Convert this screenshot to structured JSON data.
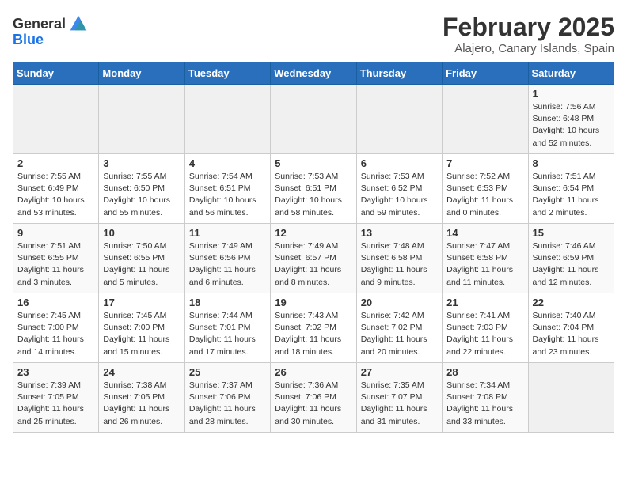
{
  "header": {
    "logo_line1": "General",
    "logo_line2": "Blue",
    "month_title": "February 2025",
    "location": "Alajero, Canary Islands, Spain"
  },
  "days_of_week": [
    "Sunday",
    "Monday",
    "Tuesday",
    "Wednesday",
    "Thursday",
    "Friday",
    "Saturday"
  ],
  "weeks": [
    {
      "days": [
        {
          "num": "",
          "info": ""
        },
        {
          "num": "",
          "info": ""
        },
        {
          "num": "",
          "info": ""
        },
        {
          "num": "",
          "info": ""
        },
        {
          "num": "",
          "info": ""
        },
        {
          "num": "",
          "info": ""
        },
        {
          "num": "1",
          "info": "Sunrise: 7:56 AM\nSunset: 6:48 PM\nDaylight: 10 hours\nand 52 minutes."
        }
      ]
    },
    {
      "days": [
        {
          "num": "2",
          "info": "Sunrise: 7:55 AM\nSunset: 6:49 PM\nDaylight: 10 hours\nand 53 minutes."
        },
        {
          "num": "3",
          "info": "Sunrise: 7:55 AM\nSunset: 6:50 PM\nDaylight: 10 hours\nand 55 minutes."
        },
        {
          "num": "4",
          "info": "Sunrise: 7:54 AM\nSunset: 6:51 PM\nDaylight: 10 hours\nand 56 minutes."
        },
        {
          "num": "5",
          "info": "Sunrise: 7:53 AM\nSunset: 6:51 PM\nDaylight: 10 hours\nand 58 minutes."
        },
        {
          "num": "6",
          "info": "Sunrise: 7:53 AM\nSunset: 6:52 PM\nDaylight: 10 hours\nand 59 minutes."
        },
        {
          "num": "7",
          "info": "Sunrise: 7:52 AM\nSunset: 6:53 PM\nDaylight: 11 hours\nand 0 minutes."
        },
        {
          "num": "8",
          "info": "Sunrise: 7:51 AM\nSunset: 6:54 PM\nDaylight: 11 hours\nand 2 minutes."
        }
      ]
    },
    {
      "days": [
        {
          "num": "9",
          "info": "Sunrise: 7:51 AM\nSunset: 6:55 PM\nDaylight: 11 hours\nand 3 minutes."
        },
        {
          "num": "10",
          "info": "Sunrise: 7:50 AM\nSunset: 6:55 PM\nDaylight: 11 hours\nand 5 minutes."
        },
        {
          "num": "11",
          "info": "Sunrise: 7:49 AM\nSunset: 6:56 PM\nDaylight: 11 hours\nand 6 minutes."
        },
        {
          "num": "12",
          "info": "Sunrise: 7:49 AM\nSunset: 6:57 PM\nDaylight: 11 hours\nand 8 minutes."
        },
        {
          "num": "13",
          "info": "Sunrise: 7:48 AM\nSunset: 6:58 PM\nDaylight: 11 hours\nand 9 minutes."
        },
        {
          "num": "14",
          "info": "Sunrise: 7:47 AM\nSunset: 6:58 PM\nDaylight: 11 hours\nand 11 minutes."
        },
        {
          "num": "15",
          "info": "Sunrise: 7:46 AM\nSunset: 6:59 PM\nDaylight: 11 hours\nand 12 minutes."
        }
      ]
    },
    {
      "days": [
        {
          "num": "16",
          "info": "Sunrise: 7:45 AM\nSunset: 7:00 PM\nDaylight: 11 hours\nand 14 minutes."
        },
        {
          "num": "17",
          "info": "Sunrise: 7:45 AM\nSunset: 7:00 PM\nDaylight: 11 hours\nand 15 minutes."
        },
        {
          "num": "18",
          "info": "Sunrise: 7:44 AM\nSunset: 7:01 PM\nDaylight: 11 hours\nand 17 minutes."
        },
        {
          "num": "19",
          "info": "Sunrise: 7:43 AM\nSunset: 7:02 PM\nDaylight: 11 hours\nand 18 minutes."
        },
        {
          "num": "20",
          "info": "Sunrise: 7:42 AM\nSunset: 7:02 PM\nDaylight: 11 hours\nand 20 minutes."
        },
        {
          "num": "21",
          "info": "Sunrise: 7:41 AM\nSunset: 7:03 PM\nDaylight: 11 hours\nand 22 minutes."
        },
        {
          "num": "22",
          "info": "Sunrise: 7:40 AM\nSunset: 7:04 PM\nDaylight: 11 hours\nand 23 minutes."
        }
      ]
    },
    {
      "days": [
        {
          "num": "23",
          "info": "Sunrise: 7:39 AM\nSunset: 7:05 PM\nDaylight: 11 hours\nand 25 minutes."
        },
        {
          "num": "24",
          "info": "Sunrise: 7:38 AM\nSunset: 7:05 PM\nDaylight: 11 hours\nand 26 minutes."
        },
        {
          "num": "25",
          "info": "Sunrise: 7:37 AM\nSunset: 7:06 PM\nDaylight: 11 hours\nand 28 minutes."
        },
        {
          "num": "26",
          "info": "Sunrise: 7:36 AM\nSunset: 7:06 PM\nDaylight: 11 hours\nand 30 minutes."
        },
        {
          "num": "27",
          "info": "Sunrise: 7:35 AM\nSunset: 7:07 PM\nDaylight: 11 hours\nand 31 minutes."
        },
        {
          "num": "28",
          "info": "Sunrise: 7:34 AM\nSunset: 7:08 PM\nDaylight: 11 hours\nand 33 minutes."
        },
        {
          "num": "",
          "info": ""
        }
      ]
    }
  ]
}
